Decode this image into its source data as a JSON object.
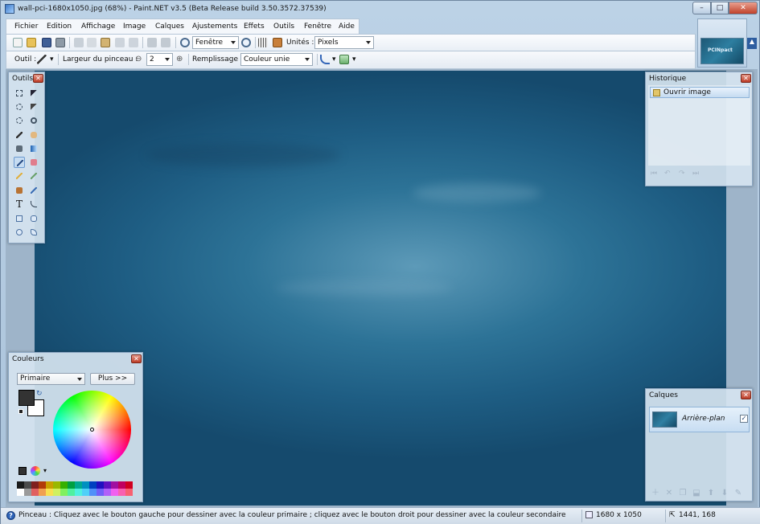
{
  "window": {
    "title": "wall-pci-1680x1050.jpg (68%) - Paint.NET v3.5 (Beta Release build 3.50.3572.37539)",
    "controls": {
      "minimize": "–",
      "maximize": "□",
      "close": "✕"
    }
  },
  "menu": {
    "items": [
      "Fichier",
      "Edition",
      "Affichage",
      "Image",
      "Calques",
      "Ajustements",
      "Effets",
      "Outils",
      "Fenêtre",
      "Aide"
    ]
  },
  "toolbar": {
    "zoom_combo": "Fenêtre",
    "units_label": "Unités :",
    "units_combo": "Pixels",
    "tool_label": "Outil :",
    "brush_width_label": "Largeur du pinceau :",
    "brush_width_value": "2",
    "fill_label": "Remplissage :",
    "fill_combo": "Couleur unie"
  },
  "thumbnail": {
    "logo_text": "PCINpact"
  },
  "tools_panel": {
    "title": "Outils",
    "selected_tool": "paintbrush",
    "tools": [
      "rectangle-select",
      "move-selection",
      "lasso-select",
      "move-selected",
      "ellipse-select",
      "zoom",
      "magic-wand",
      "pan",
      "paint-bucket",
      "gradient",
      "paintbrush",
      "eraser",
      "pencil",
      "color-picker",
      "clone-stamp",
      "recolor",
      "text",
      "line-curve",
      "rectangle",
      "rounded-rectangle",
      "ellipse",
      "freeform-shape"
    ]
  },
  "history_panel": {
    "title": "Historique",
    "items": [
      "Ouvrir image"
    ]
  },
  "colors_panel": {
    "title": "Couleurs",
    "mode_combo": "Primaire",
    "more_button": "Plus >>",
    "primary_color": "#333333",
    "secondary_color": "#ffffff",
    "palette_row1": [
      "#1a1a1a",
      "#4a4a4a",
      "#7f1f1f",
      "#b23a0a",
      "#c8a000",
      "#9ab800",
      "#36b000",
      "#00a040",
      "#00a890",
      "#0090c0",
      "#0040c0",
      "#2010c0",
      "#6010c0",
      "#a010a0",
      "#c00060",
      "#d00020"
    ],
    "palette_row2": [
      "#ffffff",
      "#9a9a9a",
      "#e06060",
      "#f0a050",
      "#f8e050",
      "#d0f060",
      "#80f060",
      "#50f0a0",
      "#50f0e0",
      "#50d0f8",
      "#5090f8",
      "#7060f8",
      "#b060f8",
      "#f060f0",
      "#f860b0",
      "#f86070"
    ]
  },
  "layers_panel": {
    "title": "Calques",
    "layers": [
      {
        "name": "Arrière-plan",
        "visible": true
      }
    ]
  },
  "status": {
    "hint": "Pinceau : Cliquez avec le bouton gauche pour dessiner avec la couleur primaire ; cliquez avec le bouton droit pour dessiner avec la couleur secondaire",
    "image_size": "1680 x 1050",
    "cursor_position": "1441, 168"
  }
}
